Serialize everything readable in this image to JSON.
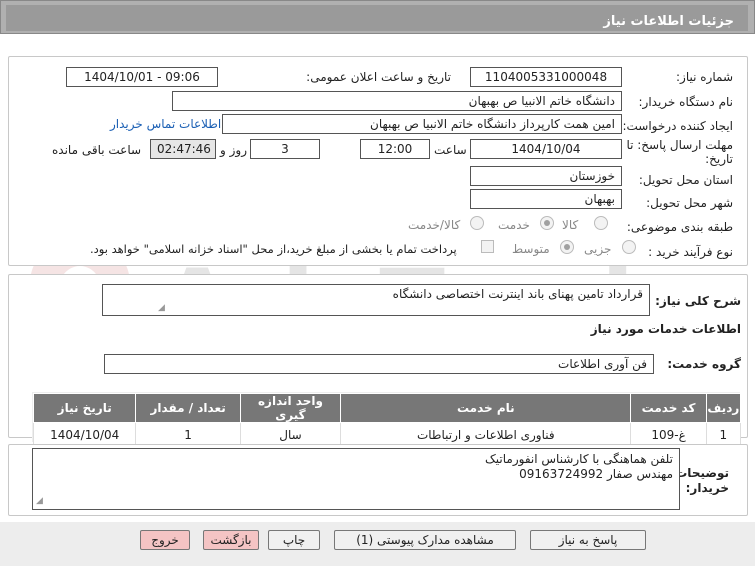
{
  "header": {
    "title": "جزئیات اطلاعات نیاز"
  },
  "form": {
    "need_number_label": "شماره نیاز:",
    "need_number": "1104005331000048",
    "announce_label": "تاریخ و ساعت اعلان عمومی:",
    "announce_value": "1404/10/01 - 09:06",
    "buyer_org_label": "نام دستگاه خریدار:",
    "buyer_org": "دانشگاه خاتم الانبیا  ص  بهبهان",
    "creator_label": "ایجاد کننده درخواست:",
    "creator": "امین همت کارپرداز دانشگاه خاتم الانبیا  ص  بهبهان",
    "contact_link": "اطلاعات تماس خریدار",
    "deadline_label_1": "مهلت ارسال پاسخ: تا",
    "deadline_label_2": "تاریخ:",
    "deadline_date": "1404/10/04",
    "time_label": "ساعت",
    "deadline_time": "12:00",
    "days_value": "3",
    "days_label": "روز و",
    "remaining_time": "02:47:46",
    "remaining_label": "ساعت باقی مانده",
    "province_label": "استان محل تحویل:",
    "province": "خوزستان",
    "city_label": "شهر محل تحویل:",
    "city": "بهبهان",
    "category_label": "طبقه بندی موضوعی:",
    "category_options": [
      "کالا",
      "خدمت",
      "کالا/خدمت"
    ],
    "process_label": "نوع فرآیند خرید :",
    "process_options": [
      "جزیی",
      "متوسط"
    ],
    "payment_note": "پرداخت تمام یا بخشی از مبلغ خرید،از محل \"اسناد خزانه اسلامی\" خواهد بود."
  },
  "description": {
    "label": "شرح کلی نیاز:",
    "value": "قرارداد تامین پهنای باند اینترنت اختصاصی دانشگاه"
  },
  "services": {
    "section_title": "اطلاعات خدمات مورد نیاز",
    "group_label": "گروه خدمت:",
    "group_value": "فن آوری اطلاعات",
    "columns": [
      "ردیف",
      "کد خدمت",
      "نام خدمت",
      "واحد اندازه گیری",
      "تعداد / مقدار",
      "تاریخ نیاز"
    ],
    "rows": [
      {
        "row": "1",
        "code": "غ-109",
        "name": "فناوری اطلاعات و ارتباطات",
        "unit": "سال",
        "qty": "1",
        "date": "1404/10/04"
      }
    ]
  },
  "buyer_notes": {
    "label_1": "توضیحات",
    "label_2": "خریدار:",
    "line1": "تلفن هماهنگی با کارشناس انفورماتیک",
    "line2": "مهندس صفار 09163724992"
  },
  "buttons": {
    "reply": "پاسخ به نیاز",
    "docs": "مشاهده مدارک پیوستی (1)",
    "print": "چاپ",
    "back": "بازگشت",
    "exit": "خروج"
  },
  "watermark": {
    "text": "AriaTender.net"
  },
  "colors": {
    "header_bg": "#9a9a9a",
    "table_header": "#777777",
    "link": "#1a5fb4",
    "pink_button": "#f4c4c4"
  }
}
